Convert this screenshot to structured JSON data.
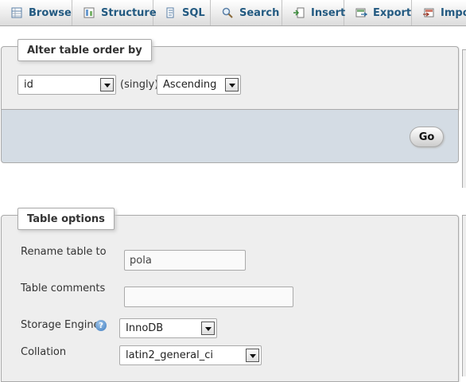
{
  "tabs": [
    {
      "label": "Browse",
      "icon": "browse-icon"
    },
    {
      "label": "Structure",
      "icon": "structure-icon"
    },
    {
      "label": "SQL",
      "icon": "sql-icon"
    },
    {
      "label": "Search",
      "icon": "search-icon"
    },
    {
      "label": "Insert",
      "icon": "insert-icon"
    },
    {
      "label": "Export",
      "icon": "export-icon"
    },
    {
      "label": "Impo",
      "icon": "import-icon"
    }
  ],
  "alter_order": {
    "legend": "Alter table order by",
    "column_select": "id",
    "singly_text": "(singly)",
    "direction_select": "Ascending",
    "go_label": "Go"
  },
  "table_options": {
    "legend": "Table options",
    "rename_label": "Rename table to",
    "rename_value": "pola",
    "comments_label": "Table comments",
    "comments_value": "",
    "engine_label": "Storage Engine",
    "engine_value": "InnoDB",
    "help_glyph": "?",
    "collation_label": "Collation",
    "collation_value": "latin2_general_ci"
  },
  "colors": {
    "tab_text": "#235a81",
    "panel_bg": "#eeeeee",
    "footer_bg": "#d4dce4",
    "border": "#aaaaaa"
  }
}
